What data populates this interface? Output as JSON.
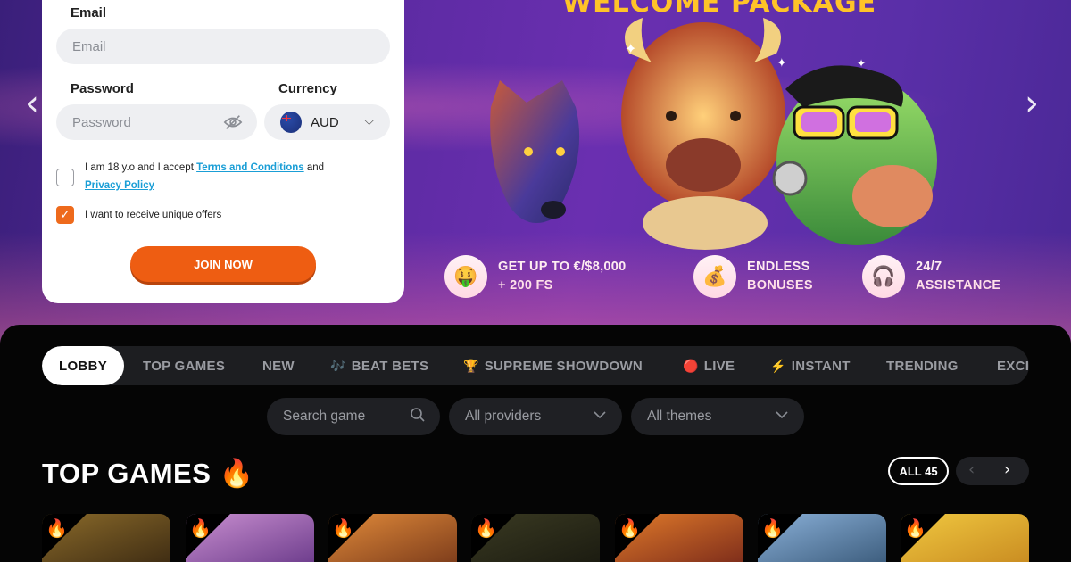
{
  "hero": {
    "title": "WELCOME PACKAGE",
    "features": [
      {
        "icon": "money-face-icon",
        "glyph": "🤑",
        "line1": "GET UP TO €/$8,000",
        "line2": "+ 200 FS"
      },
      {
        "icon": "money-bag-icon",
        "glyph": "💰",
        "line1": "ENDLESS",
        "line2": "BONUSES"
      },
      {
        "icon": "headphones-icon",
        "glyph": "🎧",
        "line1": "24/7",
        "line2": "ASSISTANCE"
      }
    ],
    "prev_arrow": "‹",
    "next_arrow": "›"
  },
  "form": {
    "email_label": "Email",
    "email_placeholder": "Email",
    "password_label": "Password",
    "password_placeholder": "Password",
    "currency_label": "Currency",
    "currency_value": "AUD",
    "terms_prefix": "I am 18 y.o and I accept ",
    "terms_link": "Terms and Conditions",
    "terms_and": " and",
    "privacy_link": "Privacy Policy",
    "terms_checked": false,
    "offers_label": "I want to receive unique offers",
    "offers_checked": true,
    "join_label": "JOIN NOW"
  },
  "tabs": [
    {
      "label": "LOBBY",
      "icon": "",
      "active": true
    },
    {
      "label": "TOP GAMES",
      "icon": ""
    },
    {
      "label": "NEW",
      "icon": ""
    },
    {
      "label": "BEAT BETS",
      "icon": "🎶"
    },
    {
      "label": "SUPREME SHOWDOWN",
      "icon": "🏆"
    },
    {
      "label": "LIVE",
      "icon": "🔴"
    },
    {
      "label": "INSTANT",
      "icon": "⚡"
    },
    {
      "label": "TRENDING",
      "icon": ""
    },
    {
      "label": "EXCI",
      "icon": ""
    }
  ],
  "filters": {
    "search_placeholder": "Search game",
    "providers": "All providers",
    "themes": "All themes"
  },
  "section": {
    "title": "TOP GAMES 🔥",
    "all_label": "ALL 45",
    "prev": "‹",
    "next": "›"
  },
  "games": [
    {
      "name": "game-tile-1",
      "colors": [
        "#8a6a2a",
        "#3c2a12"
      ]
    },
    {
      "name": "game-tile-2",
      "colors": [
        "#c98fd0",
        "#6a3a8a"
      ]
    },
    {
      "name": "game-tile-3",
      "colors": [
        "#e08a3a",
        "#7a3a1a"
      ]
    },
    {
      "name": "game-tile-4",
      "colors": [
        "#3a3a22",
        "#1a1a10"
      ]
    },
    {
      "name": "game-tile-5",
      "colors": [
        "#e07a2a",
        "#7a2a1a"
      ]
    },
    {
      "name": "game-tile-6",
      "colors": [
        "#8ab0d8",
        "#3a5a7a"
      ]
    },
    {
      "name": "game-tile-7",
      "colors": [
        "#f0c840",
        "#c88a20"
      ]
    }
  ],
  "colors": {
    "accent": "#ee5d12",
    "link": "#1a9ed6",
    "title_gold": "#ffc328"
  }
}
